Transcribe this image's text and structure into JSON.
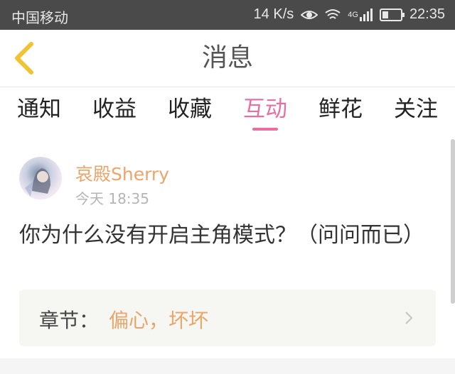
{
  "status_bar": {
    "carrier": "中国移动",
    "speed": "14 K/s",
    "network": "4G",
    "time": "22:35"
  },
  "header": {
    "title": "消息",
    "back_icon": "back-chevron-icon",
    "accent_color": "#f1c232"
  },
  "tabs": [
    {
      "label": "通知",
      "active": false
    },
    {
      "label": "收益",
      "active": false
    },
    {
      "label": "收藏",
      "active": false
    },
    {
      "label": "互动",
      "active": true
    },
    {
      "label": "鲜花",
      "active": false
    },
    {
      "label": "关注",
      "active": false
    }
  ],
  "message": {
    "author": "哀殿Sherry",
    "time": "今天 18:35",
    "content": "你为什么没有开启主角模式？（问问而已）",
    "chapter_label": "章节：",
    "chapter_title": "偏心，坏坏"
  },
  "colors": {
    "active_tab": "#e96fa3",
    "author": "#e9a56a",
    "status_bar_bg": "#4a4a4a"
  }
}
